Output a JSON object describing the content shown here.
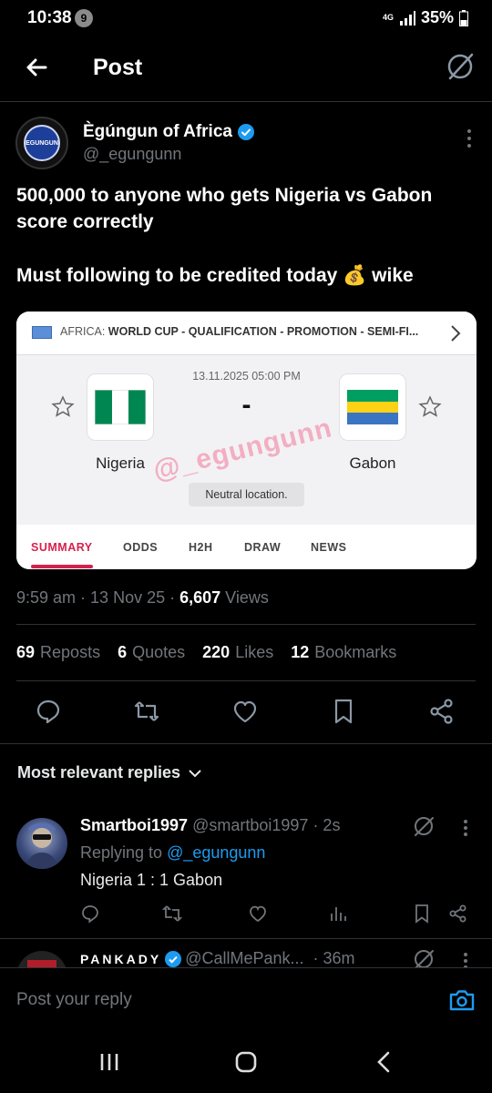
{
  "status_bar": {
    "time": "10:38",
    "notification_count": "9",
    "network": "4G",
    "battery": "35%"
  },
  "header": {
    "title": "Post"
  },
  "post": {
    "author_name": "Ègúngun of Africa",
    "author_handle": "@_egungunn",
    "avatar_text": "EGUNGUN",
    "text_line1": "500,000 to anyone who gets Nigeria vs Gabon score correctly",
    "text_line2": "Must following to be credited today 💰 wike",
    "time": "9:59 am",
    "date": "13 Nov 25",
    "views_count": "6,607",
    "views_label": "Views",
    "stats": {
      "reposts_count": "69",
      "reposts_label": "Reposts",
      "quotes_count": "6",
      "quotes_label": "Quotes",
      "likes_count": "220",
      "likes_label": "Likes",
      "bookmarks_count": "12",
      "bookmarks_label": "Bookmarks"
    }
  },
  "match_card": {
    "region": "AFRICA:",
    "competition": "WORLD CUP - QUALIFICATION - PROMOTION - SEMI-FI...",
    "datetime": "13.11.2025 05:00 PM",
    "score": "-",
    "home_team": "Nigeria",
    "away_team": "Gabon",
    "watermark": "@_egungunn",
    "venue_note": "Neutral location.",
    "tabs": [
      "SUMMARY",
      "ODDS",
      "H2H",
      "DRAW",
      "NEWS"
    ],
    "active_tab": "SUMMARY",
    "colors": {
      "accent": "#d6214e",
      "nigeria_green": "#008751",
      "gabon_green": "#009e60",
      "gabon_yellow": "#fcd116",
      "gabon_blue": "#3a75c4"
    }
  },
  "replies_section": {
    "label": "Most relevant replies"
  },
  "replies": [
    {
      "name": "Smartboi1997",
      "handle": "@smartboi1997",
      "time": "· 2s",
      "replying_prefix": "Replying to",
      "replying_to": "@_egungunn",
      "text": "Nigeria 1 : 1 Gabon"
    },
    {
      "name": "PANKADY",
      "handle": "@CallMePank...",
      "time": "· 36m"
    }
  ],
  "composer": {
    "placeholder": "Post your reply"
  },
  "colors": {
    "background": "#000000",
    "text_primary": "#e7e9ea",
    "text_secondary": "#71767b",
    "link": "#1d9bf0",
    "separator": "#2f3336"
  }
}
